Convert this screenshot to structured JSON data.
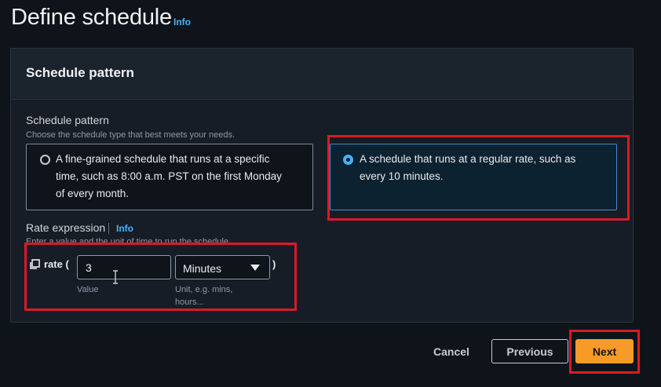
{
  "page": {
    "title": "Define schedule",
    "info_link": "Info"
  },
  "panel": {
    "title": "Schedule pattern"
  },
  "schedule_pattern": {
    "label": "Schedule pattern",
    "description": "Choose the schedule type that best meets your needs.",
    "options": [
      {
        "label_lines": [
          "A fine-grained schedule that runs at a specific",
          "time, such as 8:00 a.m. PST on the first Monday",
          "of every month."
        ],
        "selected": false
      },
      {
        "label_lines": [
          "A schedule that runs at a regular rate, such as",
          "every 10 minutes."
        ],
        "selected": true
      }
    ]
  },
  "rate_expression": {
    "label": "Rate expression",
    "info_link": "Info",
    "description": "Enter a value and the unit of time to run the schedule.",
    "prefix": "rate (",
    "suffix": ")",
    "value": "3",
    "value_hint": "Value",
    "unit": "Minutes",
    "unit_hint_lines": [
      "Unit, e.g. mins,",
      "hours..."
    ]
  },
  "footer": {
    "cancel_label": "Cancel",
    "previous_label": "Previous",
    "next_label": "Next"
  },
  "colors": {
    "highlight": "#d91a26",
    "primary": "#f79b28",
    "link": "#42b4ff"
  },
  "icons": [
    "copy-icon",
    "chevron-down-icon",
    "text-cursor-icon"
  ]
}
